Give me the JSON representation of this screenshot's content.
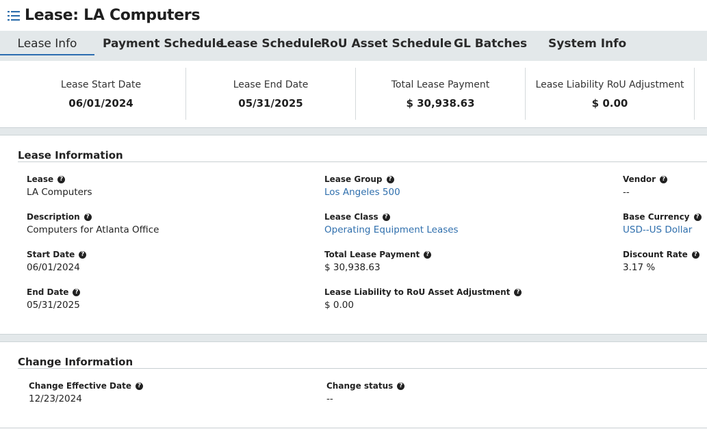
{
  "page": {
    "title": "Lease: LA Computers"
  },
  "tabs": [
    {
      "label": "Lease Info"
    },
    {
      "label": "Payment Schedule"
    },
    {
      "label": "Lease Schedule"
    },
    {
      "label": "RoU Asset Schedule"
    },
    {
      "label": "GL Batches"
    },
    {
      "label": "System Info"
    }
  ],
  "summary": [
    {
      "label": "Lease Start Date",
      "value": "06/01/2024"
    },
    {
      "label": "Lease End Date",
      "value": "05/31/2025"
    },
    {
      "label": "Total Lease Payment",
      "value": "$ 30,938.63"
    },
    {
      "label": "Lease Liability RoU Adjustment",
      "value": "$ 0.00"
    }
  ],
  "lease_info": {
    "title": "Lease Information",
    "lease": {
      "label": "Lease",
      "value": "LA Computers"
    },
    "description": {
      "label": "Description",
      "value": "Computers for Atlanta Office"
    },
    "start_date": {
      "label": "Start Date",
      "value": "06/01/2024"
    },
    "end_date": {
      "label": "End Date",
      "value": "05/31/2025"
    },
    "lease_group": {
      "label": "Lease Group",
      "value": "Los Angeles 500"
    },
    "lease_class": {
      "label": "Lease Class",
      "value": "Operating Equipment Leases"
    },
    "total_payment": {
      "label": "Total Lease Payment",
      "value": "$ 30,938.63"
    },
    "liability_adj": {
      "label": "Lease Liability to RoU Asset Adjustment",
      "value": "$ 0.00"
    },
    "vendor": {
      "label": "Vendor",
      "value": "--"
    },
    "base_currency": {
      "label": "Base Currency",
      "value": "USD--US Dollar"
    },
    "discount_rate": {
      "label": "Discount Rate",
      "value": "3.17 %"
    }
  },
  "change_info": {
    "title": "Change Information",
    "effective_date": {
      "label": "Change Effective Date",
      "value": "12/23/2024"
    },
    "status": {
      "label": "Change status",
      "value": "--"
    }
  },
  "help_glyph": "?",
  "colors": {
    "link": "#2f6fad",
    "band": "#e3e8ea",
    "accent": "#2b6cb0"
  }
}
